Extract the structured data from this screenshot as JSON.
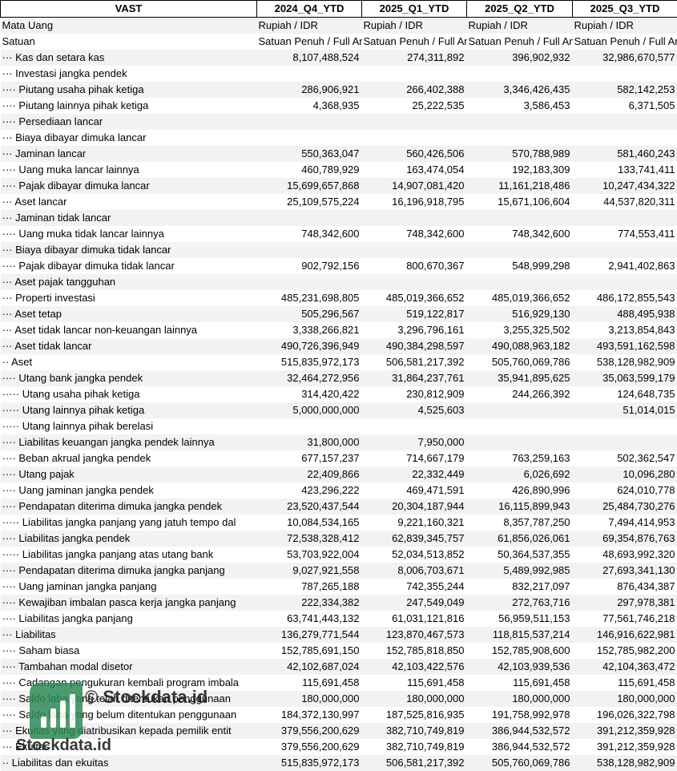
{
  "headers": [
    "VAST",
    "2024_Q4_YTD",
    "2025_Q1_YTD",
    "2025_Q2_YTD",
    "2025_Q3_YTD"
  ],
  "meta_rows": [
    {
      "label": "Mata Uang",
      "values": [
        "Rupiah / IDR",
        "Rupiah / IDR",
        "Rupiah / IDR",
        "Rupiah / IDR"
      ]
    },
    {
      "label": "Satuan",
      "values": [
        "Satuan Penuh / Full Amount",
        "Satuan Penuh / Full Amount",
        "Satuan Penuh / Full Amount",
        "Satuan Penuh / Full Amount"
      ]
    }
  ],
  "rows": [
    {
      "label": "··· Kas dan setara kas",
      "values": [
        "8,107,488,524",
        "274,311,892",
        "396,902,932",
        "32,986,670,577"
      ]
    },
    {
      "label": "··· Investasi jangka pendek",
      "values": [
        "",
        "",
        "",
        ""
      ]
    },
    {
      "label": "···· Piutang usaha pihak ketiga",
      "values": [
        "286,906,921",
        "266,402,388",
        "3,346,426,435",
        "582,142,253"
      ]
    },
    {
      "label": "···· Piutang lainnya pihak ketiga",
      "values": [
        "4,368,935",
        "25,222,535",
        "3,586,453",
        "6,371,505"
      ]
    },
    {
      "label": "···· Persediaan lancar",
      "values": [
        "",
        "",
        "",
        ""
      ]
    },
    {
      "label": "··· Biaya dibayar dimuka lancar",
      "values": [
        "",
        "",
        "",
        ""
      ]
    },
    {
      "label": "··· Jaminan lancar",
      "values": [
        "550,363,047",
        "560,426,506",
        "570,788,989",
        "581,460,243"
      ]
    },
    {
      "label": "···· Uang muka lancar lainnya",
      "values": [
        "460,789,929",
        "163,474,054",
        "192,183,309",
        "133,741,411"
      ]
    },
    {
      "label": "···· Pajak dibayar dimuka lancar",
      "values": [
        "15,699,657,868",
        "14,907,081,420",
        "11,161,218,486",
        "10,247,434,322"
      ]
    },
    {
      "label": "··· Aset lancar",
      "values": [
        "25,109,575,224",
        "16,196,918,795",
        "15,671,106,604",
        "44,537,820,311"
      ]
    },
    {
      "label": "··· Jaminan tidak lancar",
      "values": [
        "",
        "",
        "",
        ""
      ]
    },
    {
      "label": "···· Uang muka tidak lancar lainnya",
      "values": [
        "748,342,600",
        "748,342,600",
        "748,342,600",
        "774,553,411"
      ]
    },
    {
      "label": "··· Biaya dibayar dimuka tidak lancar",
      "values": [
        "",
        "",
        "",
        ""
      ]
    },
    {
      "label": "···· Pajak dibayar dimuka tidak lancar",
      "values": [
        "902,792,156",
        "800,670,367",
        "548,999,298",
        "2,941,402,863"
      ]
    },
    {
      "label": "··· Aset pajak tangguhan",
      "values": [
        "",
        "",
        "",
        ""
      ]
    },
    {
      "label": "··· Properti investasi",
      "values": [
        "485,231,698,805",
        "485,019,366,652",
        "485,019,366,652",
        "486,172,855,543"
      ]
    },
    {
      "label": "··· Aset tetap",
      "values": [
        "505,296,567",
        "519,122,817",
        "516,929,130",
        "488,495,938"
      ]
    },
    {
      "label": "··· Aset tidak lancar non-keuangan lainnya",
      "values": [
        "3,338,266,821",
        "3,296,796,161",
        "3,255,325,502",
        "3,213,854,843"
      ]
    },
    {
      "label": "··· Aset tidak lancar",
      "values": [
        "490,726,396,949",
        "490,384,298,597",
        "490,088,963,182",
        "493,591,162,598"
      ]
    },
    {
      "label": "·· Aset",
      "values": [
        "515,835,972,173",
        "506,581,217,392",
        "505,760,069,786",
        "538,128,982,909"
      ]
    },
    {
      "label": "···· Utang bank jangka pendek",
      "values": [
        "32,464,272,956",
        "31,864,237,761",
        "35,941,895,625",
        "35,063,599,179"
      ]
    },
    {
      "label": "····· Utang usaha pihak ketiga",
      "values": [
        "314,420,422",
        "230,812,909",
        "244,266,392",
        "124,648,735"
      ]
    },
    {
      "label": "····· Utang lainnya pihak ketiga",
      "values": [
        "5,000,000,000",
        "4,525,603",
        "",
        "51,014,015"
      ]
    },
    {
      "label": "····· Utang lainnya pihak berelasi",
      "values": [
        "",
        "",
        "",
        ""
      ]
    },
    {
      "label": "···· Liabilitas keuangan jangka pendek lainnya",
      "values": [
        "31,800,000",
        "7,950,000",
        "",
        ""
      ]
    },
    {
      "label": "···· Beban akrual jangka pendek",
      "values": [
        "677,157,237",
        "714,667,179",
        "763,259,163",
        "502,362,547"
      ]
    },
    {
      "label": "···· Utang pajak",
      "values": [
        "22,409,866",
        "22,332,449",
        "6,026,692",
        "10,096,280"
      ]
    },
    {
      "label": "···· Uang jaminan jangka pendek",
      "values": [
        "423,296,222",
        "469,471,591",
        "426,890,996",
        "624,010,778"
      ]
    },
    {
      "label": "···· Pendapatan diterima dimuka jangka pendek",
      "values": [
        "23,520,437,544",
        "20,304,187,944",
        "16,115,899,943",
        "25,484,730,276"
      ]
    },
    {
      "label": "····· Liabilitas jangka panjang yang jatuh tempo dal",
      "values": [
        "10,084,534,165",
        "9,221,160,321",
        "8,357,787,250",
        "7,494,414,953"
      ]
    },
    {
      "label": "···· Liabilitas jangka pendek",
      "values": [
        "72,538,328,412",
        "62,839,345,757",
        "61,856,026,061",
        "69,354,876,763"
      ]
    },
    {
      "label": "····· Liabilitas jangka panjang atas utang bank",
      "values": [
        "53,703,922,004",
        "52,034,513,852",
        "50,364,537,355",
        "48,693,992,320"
      ]
    },
    {
      "label": "···· Pendapatan diterima dimuka jangka panjang",
      "values": [
        "9,027,921,558",
        "8,006,703,671",
        "5,489,992,985",
        "27,693,341,130"
      ]
    },
    {
      "label": "···· Uang jaminan jangka panjang",
      "values": [
        "787,265,188",
        "742,355,244",
        "832,217,097",
        "876,434,387"
      ]
    },
    {
      "label": "···· Kewajiban imbalan pasca kerja jangka panjang",
      "values": [
        "222,334,382",
        "247,549,049",
        "272,763,716",
        "297,978,381"
      ]
    },
    {
      "label": "···· Liabilitas jangka panjang",
      "values": [
        "63,741,443,132",
        "61,031,121,816",
        "56,959,511,153",
        "77,561,746,218"
      ]
    },
    {
      "label": "··· Liabilitas",
      "values": [
        "136,279,771,544",
        "123,870,467,573",
        "118,815,537,214",
        "146,916,622,981"
      ]
    },
    {
      "label": "···· Saham biasa",
      "values": [
        "152,785,691,150",
        "152,785,818,850",
        "152,785,908,600",
        "152,785,982,200"
      ]
    },
    {
      "label": "···· Tambahan modal disetor",
      "values": [
        "42,102,687,024",
        "42,103,422,576",
        "42,103,939,536",
        "42,104,363,472"
      ]
    },
    {
      "label": "···· Cadangan pengukuran kembali program imbala",
      "values": [
        "115,691,458",
        "115,691,458",
        "115,691,458",
        "115,691,458"
      ]
    },
    {
      "label": "···· Saldo laba yang telah ditentukan penggunaan",
      "values": [
        "180,000,000",
        "180,000,000",
        "180,000,000",
        "180,000,000"
      ]
    },
    {
      "label": "···· Saldo laba yang belum ditentukan penggunaan",
      "values": [
        "184,372,130,997",
        "187,525,816,935",
        "191,758,992,978",
        "196,026,322,798"
      ]
    },
    {
      "label": "··· Ekuitas yang diatribusikan kepada pemilik entit",
      "values": [
        "379,556,200,629",
        "382,710,749,819",
        "386,944,532,572",
        "391,212,359,928"
      ]
    },
    {
      "label": "··· Ekuitas",
      "values": [
        "379,556,200,629",
        "382,710,749,819",
        "386,944,532,572",
        "391,212,359,928"
      ]
    },
    {
      "label": "·· Liabilitas dan ekuitas",
      "values": [
        "515,835,972,173",
        "506,581,217,392",
        "505,760,069,786",
        "538,128,982,909"
      ]
    }
  ],
  "watermark": {
    "text_top": "© Stockdata.id",
    "text_bottom": "Stockdata.id",
    "color": "#2e8b57"
  }
}
